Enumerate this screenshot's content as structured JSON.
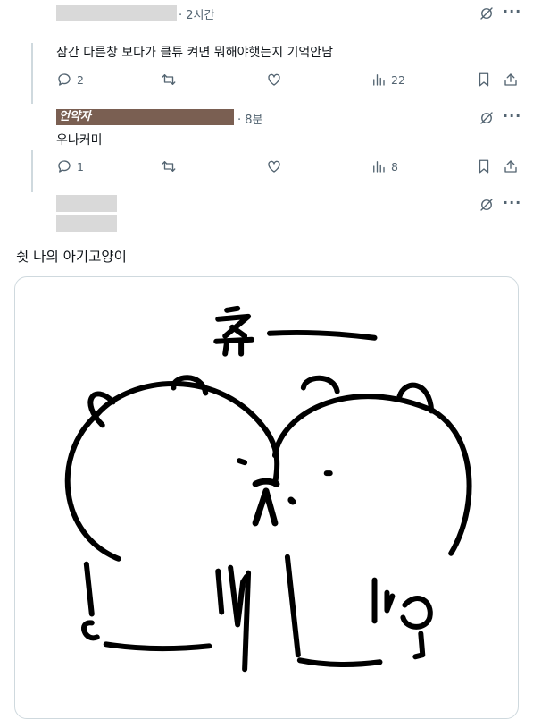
{
  "reply1": {
    "time": "· 2시간"
  },
  "reply2": {
    "text": "잠간 다른창 보다가 클튜 켜면 뭐해야햇는지 기억안남",
    "replies": "2",
    "views": "22"
  },
  "reply3": {
    "name": "언약자",
    "time": "· 8분",
    "text": "우나커미",
    "replies": "1",
    "views": "8"
  },
  "main_tweet": {
    "text": "쉿 나의 아기고양이",
    "image": {
      "drawn_text_top": "츄 —",
      "drawn_text_left": "우—니",
      "drawn_text_right": "니—잉"
    }
  },
  "icons": [
    "grok-icon",
    "more-icon",
    "reply-icon",
    "retweet-icon",
    "like-icon",
    "views-icon",
    "bookmark-icon",
    "share-icon"
  ]
}
